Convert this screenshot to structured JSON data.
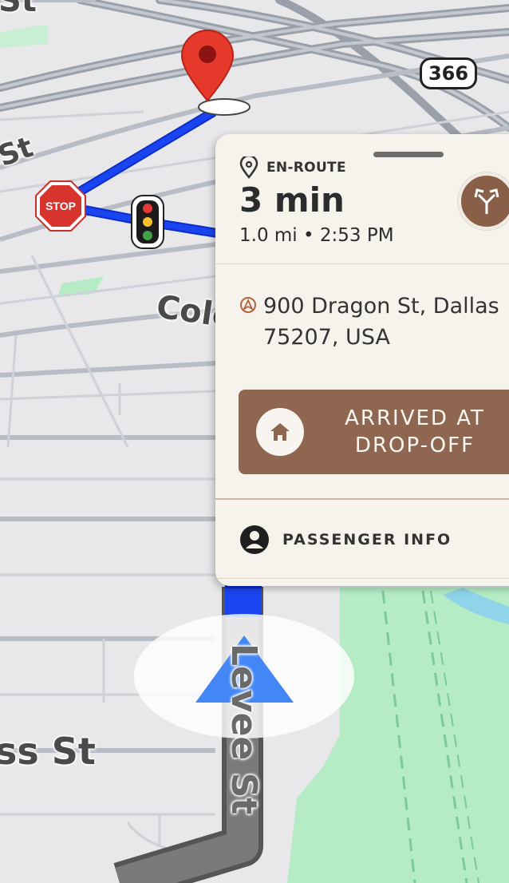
{
  "map": {
    "street_labels": {
      "top_left": "St",
      "left_st": "St",
      "cole": "Cole",
      "bottom_left": "ss St",
      "vertical": "Levee St"
    },
    "highway_shield": "366",
    "stop_sign_text": "STOP",
    "colors": {
      "route": "#1a44f0",
      "water": "#b5ecc6",
      "pin": "#e5392b",
      "arrow": "#4287f5"
    }
  },
  "trip_card": {
    "status_icon": "location-pin-outline-icon",
    "status": "EN-ROUTE",
    "eta": "3 min",
    "eta_details": "1.0 mi • 2:53 PM",
    "route_options_icon": "fork-arrows-icon",
    "address_icon": "navigation-circle-icon",
    "address_line1": "900 Dragon St, Dallas",
    "address_line2": "75207, USA",
    "arrive_icon": "home-icon",
    "arrive_button": "ARRIVED AT DROP-OFF",
    "passenger_icon": "person-circle-icon",
    "passenger_info": "PASSENGER INFO",
    "accent_color": "#8f6650"
  }
}
